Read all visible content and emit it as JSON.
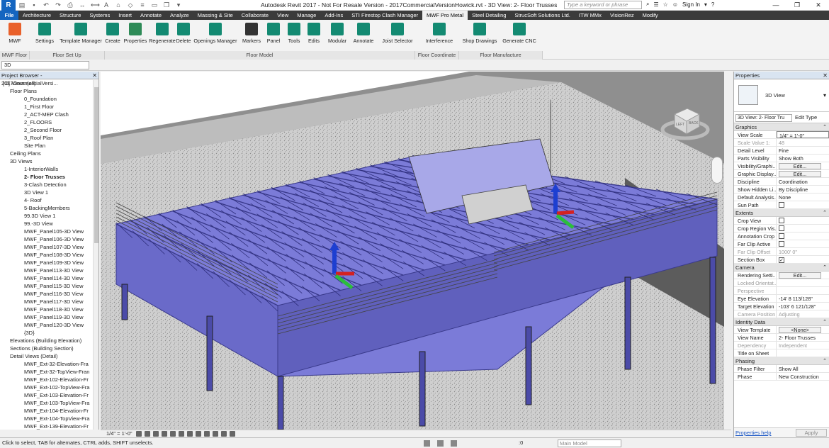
{
  "titlebar": {
    "app_letter": "R",
    "title": "Autodesk Revit 2017 -  Not For Resale Version -    2017CommercialVersionHowick.rvt - 3D View: 2- Floor Trusses",
    "search_placeholder": "Type a keyword or phrase",
    "sign_in": "Sign In"
  },
  "ribbon_tabs": [
    "File",
    "Architecture",
    "Structure",
    "Systems",
    "Insert",
    "Annotate",
    "Analyze",
    "Massing & Site",
    "Collaborate",
    "View",
    "Manage",
    "Add-Ins",
    "STI Firestop Clash Manager",
    "MWF Pro Metal",
    "Steel Detailing",
    "StrucSoft Solutions Ltd.",
    "ITW MMx",
    "VisionRez",
    "Modify"
  ],
  "active_tab": "MWF Pro Metal",
  "ribbon": {
    "buttons": [
      {
        "label": "MWF",
        "icon": "mwf-logo-icon"
      },
      {
        "label": "Settings",
        "icon": "gears-icon"
      },
      {
        "label": "Template Manager",
        "icon": "template-icon"
      },
      {
        "label": "Create",
        "icon": "create-icon"
      },
      {
        "label": "Properties",
        "icon": "properties-icon"
      },
      {
        "label": "Regenerate",
        "icon": "regenerate-icon"
      },
      {
        "label": "Delete",
        "icon": "delete-icon"
      },
      {
        "label": "Openings Manager",
        "icon": "openings-icon"
      },
      {
        "label": "Markers",
        "icon": "markers-icon"
      },
      {
        "label": "Panel",
        "icon": "panel-icon"
      },
      {
        "label": "Tools",
        "icon": "tools-icon"
      },
      {
        "label": "Edits",
        "icon": "edits-icon"
      },
      {
        "label": "Modular",
        "icon": "modular-icon"
      },
      {
        "label": "Annotate",
        "icon": "annotate-icon"
      },
      {
        "label": "Joist Selector",
        "icon": "joist-selector-icon"
      },
      {
        "label": "Interference",
        "icon": "interference-icon"
      },
      {
        "label": "Shop Drawings",
        "icon": "printer-icon"
      },
      {
        "label": "Generate CNC",
        "icon": "factory-icon"
      }
    ],
    "panels": [
      "MWF Floor",
      "Floor Set Up",
      "Floor Model",
      "Floor Coordinate",
      "Floor Manufacture"
    ]
  },
  "type_selector": "3D",
  "project_browser": {
    "title": "Project Browser - 2017CommercialVersi...",
    "items": [
      {
        "label": "[O] Views (all)",
        "indent": 0,
        "bold": false
      },
      {
        "label": "Floor Plans",
        "indent": 1,
        "bold": false
      },
      {
        "label": "0_Foundation",
        "indent": 3,
        "bold": false
      },
      {
        "label": "1_First Floor",
        "indent": 3,
        "bold": false
      },
      {
        "label": "2_ACT-MEP Clash",
        "indent": 3,
        "bold": false
      },
      {
        "label": "2_FLOORS",
        "indent": 3,
        "bold": false
      },
      {
        "label": "2_Second Floor",
        "indent": 3,
        "bold": false
      },
      {
        "label": "3_Roof Plan",
        "indent": 3,
        "bold": false
      },
      {
        "label": "Site Plan",
        "indent": 3,
        "bold": false
      },
      {
        "label": "Ceiling Plans",
        "indent": 1,
        "bold": false
      },
      {
        "label": "3D Views",
        "indent": 1,
        "bold": false
      },
      {
        "label": "1-InteriorWalls",
        "indent": 3,
        "bold": false
      },
      {
        "label": "2- Floor Trusses",
        "indent": 3,
        "bold": true
      },
      {
        "label": "3-Clash Detection",
        "indent": 3,
        "bold": false
      },
      {
        "label": "3D View 1",
        "indent": 3,
        "bold": false
      },
      {
        "label": "4- Roof",
        "indent": 3,
        "bold": false
      },
      {
        "label": "5-BackingMembers",
        "indent": 3,
        "bold": false
      },
      {
        "label": "99.3D View 1",
        "indent": 3,
        "bold": false
      },
      {
        "label": "99.-3D View",
        "indent": 3,
        "bold": false
      },
      {
        "label": "MWF_Panel105-3D View",
        "indent": 3,
        "bold": false
      },
      {
        "label": "MWF_Panel106-3D View",
        "indent": 3,
        "bold": false
      },
      {
        "label": "MWF_Panel107-3D View",
        "indent": 3,
        "bold": false
      },
      {
        "label": "MWF_Panel108-3D View",
        "indent": 3,
        "bold": false
      },
      {
        "label": "MWF_Panel109-3D View",
        "indent": 3,
        "bold": false
      },
      {
        "label": "MWF_Panel113-3D View",
        "indent": 3,
        "bold": false
      },
      {
        "label": "MWF_Panel114-3D View",
        "indent": 3,
        "bold": false
      },
      {
        "label": "MWF_Panel115-3D View",
        "indent": 3,
        "bold": false
      },
      {
        "label": "MWF_Panel116-3D View",
        "indent": 3,
        "bold": false
      },
      {
        "label": "MWF_Panel117-3D View",
        "indent": 3,
        "bold": false
      },
      {
        "label": "MWF_Panel118-3D View",
        "indent": 3,
        "bold": false
      },
      {
        "label": "MWF_Panel119-3D View",
        "indent": 3,
        "bold": false
      },
      {
        "label": "MWF_Panel120-3D View",
        "indent": 3,
        "bold": false
      },
      {
        "label": "{3D}",
        "indent": 3,
        "bold": false
      },
      {
        "label": "Elevations (Building Elevation)",
        "indent": 1,
        "bold": false
      },
      {
        "label": "Sections (Building Section)",
        "indent": 1,
        "bold": false
      },
      {
        "label": "Detail Views (Detail)",
        "indent": 1,
        "bold": false
      },
      {
        "label": "MWF_Ext-32-Elevation-Fra",
        "indent": 3,
        "bold": false
      },
      {
        "label": "MWF_Ext-32-TopView-Fran",
        "indent": 3,
        "bold": false
      },
      {
        "label": "MWF_Ext-102-Elevation-Fr",
        "indent": 3,
        "bold": false
      },
      {
        "label": "MWF_Ext-102-TopView-Fra",
        "indent": 3,
        "bold": false
      },
      {
        "label": "MWF_Ext-103-Elevation-Fr",
        "indent": 3,
        "bold": false
      },
      {
        "label": "MWF_Ext-103-TopView-Fra",
        "indent": 3,
        "bold": false
      },
      {
        "label": "MWF_Ext-104-Elevation-Fr",
        "indent": 3,
        "bold": false
      },
      {
        "label": "MWF_Ext-104-TopView-Fra",
        "indent": 3,
        "bold": false
      },
      {
        "label": "MWF_Ext-139-Elevation-Fr",
        "indent": 3,
        "bold": false
      }
    ]
  },
  "viewcube": {
    "left": "LEFT",
    "back": "BACK"
  },
  "view_control_bar": {
    "scale": "1/4\" = 1'-0\""
  },
  "properties": {
    "title": "Properties",
    "type_name": "3D View",
    "instance_selector": "3D View: 2- Floor Tru",
    "edit_type": "Edit Type",
    "sections": [
      {
        "name": "Graphics",
        "rows": [
          {
            "k": "View Scale",
            "v": "1/4\" = 1'-0\"",
            "kind": "input"
          },
          {
            "k": "Scale Value  1:",
            "v": "48",
            "kind": "grey"
          },
          {
            "k": "Detail Level",
            "v": "Fine",
            "kind": "text"
          },
          {
            "k": "Parts Visibility",
            "v": "Show Both",
            "kind": "text"
          },
          {
            "k": "Visibility/Graphi...",
            "v": "Edit...",
            "kind": "button"
          },
          {
            "k": "Graphic Display...",
            "v": "Edit...",
            "kind": "button"
          },
          {
            "k": "Discipline",
            "v": "Coordination",
            "kind": "text"
          },
          {
            "k": "Show Hidden Li...",
            "v": "By Discipline",
            "kind": "text"
          },
          {
            "k": "Default Analysis...",
            "v": "None",
            "kind": "text"
          },
          {
            "k": "Sun Path",
            "v": "",
            "kind": "check"
          }
        ]
      },
      {
        "name": "Extents",
        "rows": [
          {
            "k": "Crop View",
            "v": "",
            "kind": "check"
          },
          {
            "k": "Crop Region Vis...",
            "v": "",
            "kind": "check"
          },
          {
            "k": "Annotation Crop",
            "v": "",
            "kind": "check"
          },
          {
            "k": "Far Clip Active",
            "v": "",
            "kind": "check"
          },
          {
            "k": "Far Clip Offset",
            "v": "1000' 0\"",
            "kind": "grey"
          },
          {
            "k": "Section Box",
            "v": "✓",
            "kind": "check"
          }
        ]
      },
      {
        "name": "Camera",
        "rows": [
          {
            "k": "Rendering Setti...",
            "v": "Edit...",
            "kind": "button"
          },
          {
            "k": "Locked Orientat...",
            "v": "",
            "kind": "grey"
          },
          {
            "k": "Perspective",
            "v": "",
            "kind": "grey"
          },
          {
            "k": "Eye Elevation",
            "v": "-14'  8 113/128\"",
            "kind": "text"
          },
          {
            "k": "Target Elevation",
            "v": "-103'  6 121/128\"",
            "kind": "text"
          },
          {
            "k": "Camera Position",
            "v": "Adjusting",
            "kind": "grey"
          }
        ]
      },
      {
        "name": "Identity Data",
        "rows": [
          {
            "k": "View Template",
            "v": "<None>",
            "kind": "button"
          },
          {
            "k": "View Name",
            "v": "2- Floor Trusses",
            "kind": "text"
          },
          {
            "k": "Dependency",
            "v": "Independent",
            "kind": "grey"
          },
          {
            "k": "Title on Sheet",
            "v": "",
            "kind": "text"
          }
        ]
      },
      {
        "name": "Phasing",
        "rows": [
          {
            "k": "Phase Filter",
            "v": "Show All",
            "kind": "text"
          },
          {
            "k": "Phase",
            "v": "New Construction",
            "kind": "text"
          }
        ]
      }
    ],
    "help": "Properties help",
    "apply": "Apply"
  },
  "status": {
    "text": "Click to select, TAB for alternates, CTRL adds, SHIFT unselects.",
    "count": ":0",
    "model": "Main Model"
  },
  "colors": {
    "tab_bar": "#3b3b3b",
    "file_tab": "#1565c0",
    "truss": "#7b7bd8",
    "truss_dark": "#3a3a8c"
  }
}
